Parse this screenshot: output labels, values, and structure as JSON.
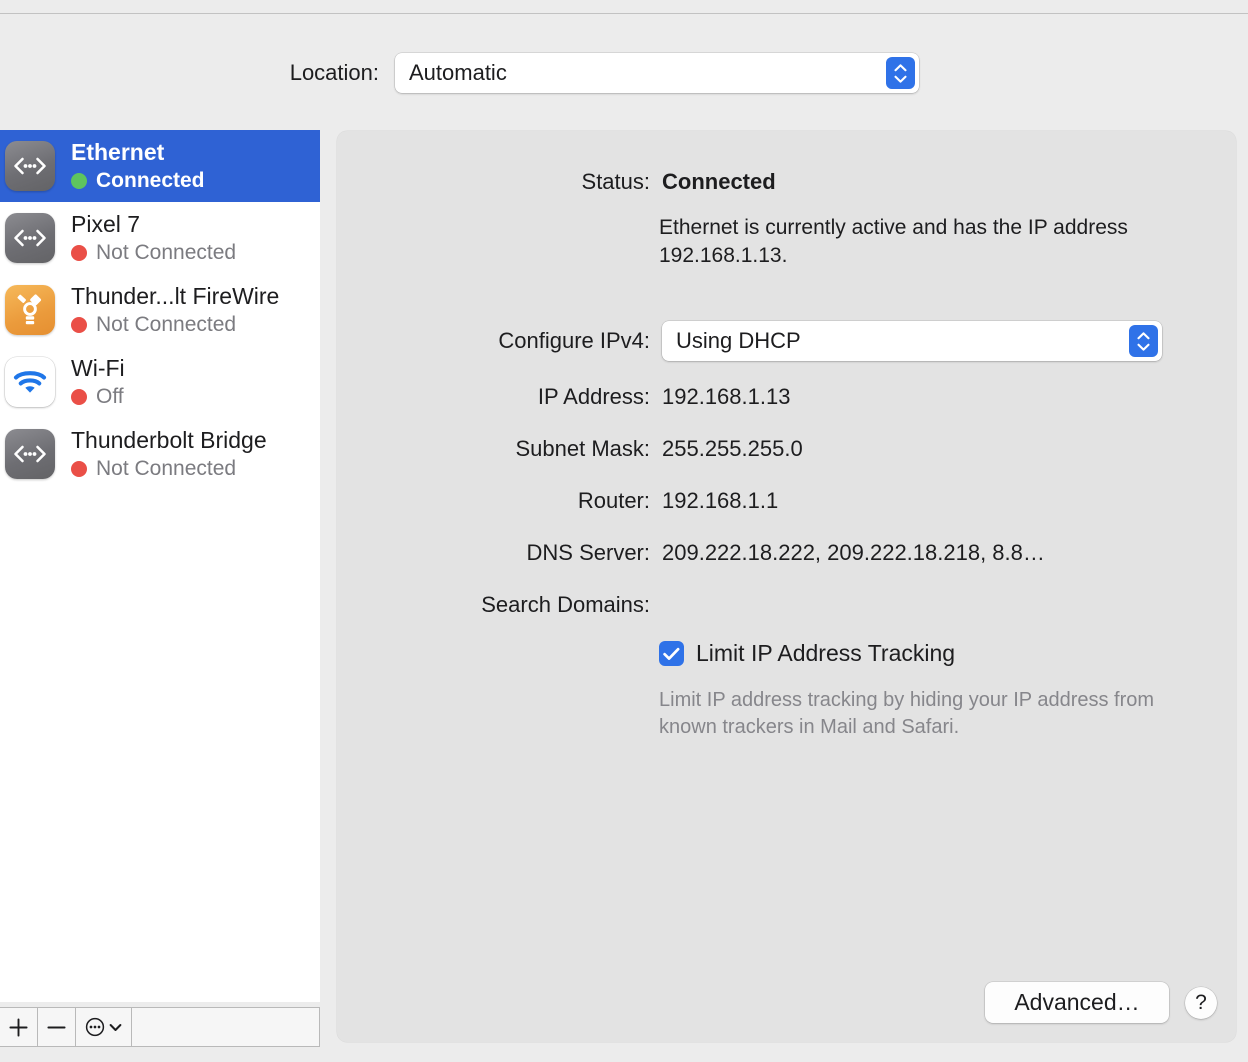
{
  "location": {
    "label": "Location:",
    "value": "Automatic"
  },
  "sidebar": {
    "services": [
      {
        "name": "Ethernet",
        "status": "Connected",
        "status_color": "#5ec45e",
        "icon": "ethernet-icon",
        "selected": true
      },
      {
        "name": "Pixel 7",
        "status": "Not Connected",
        "status_color": "#ea4f47",
        "icon": "ethernet-icon",
        "selected": false
      },
      {
        "name": "Thunder...lt FireWire",
        "status": "Not Connected",
        "status_color": "#ea4f47",
        "icon": "firewire-icon",
        "selected": false
      },
      {
        "name": "Wi-Fi",
        "status": "Off",
        "status_color": "#ea4f47",
        "icon": "wifi-icon",
        "selected": false
      },
      {
        "name": "Thunderbolt Bridge",
        "status": "Not Connected",
        "status_color": "#ea4f47",
        "icon": "ethernet-icon",
        "selected": false
      }
    ],
    "toolbar": {
      "add": "+",
      "remove": "−",
      "actions": "more-options"
    }
  },
  "detail": {
    "status_label": "Status:",
    "status_value": "Connected",
    "status_description": "Ethernet is currently active and has the IP address 192.168.1.13.",
    "configure_ipv4_label": "Configure IPv4:",
    "configure_ipv4_value": "Using DHCP",
    "ip_address_label": "IP Address:",
    "ip_address_value": "192.168.1.13",
    "subnet_mask_label": "Subnet Mask:",
    "subnet_mask_value": "255.255.255.0",
    "router_label": "Router:",
    "router_value": "192.168.1.1",
    "dns_server_label": "DNS Server:",
    "dns_server_value": "209.222.18.222, 209.222.18.218, 8.8…",
    "search_domains_label": "Search Domains:",
    "search_domains_value": "",
    "limit_tracking_label": "Limit IP Address Tracking",
    "limit_tracking_checked": true,
    "limit_tracking_description": "Limit IP address tracking by hiding your IP address from known trackers in Mail and Safari.",
    "advanced_button": "Advanced…",
    "help_button": "?"
  },
  "colors": {
    "accent": "#2f72e8",
    "selection": "#2f62d4",
    "connected": "#5ec45e",
    "disconnected": "#ea4f47",
    "window_bg": "#ececec",
    "panel_bg": "#e3e3e3"
  }
}
